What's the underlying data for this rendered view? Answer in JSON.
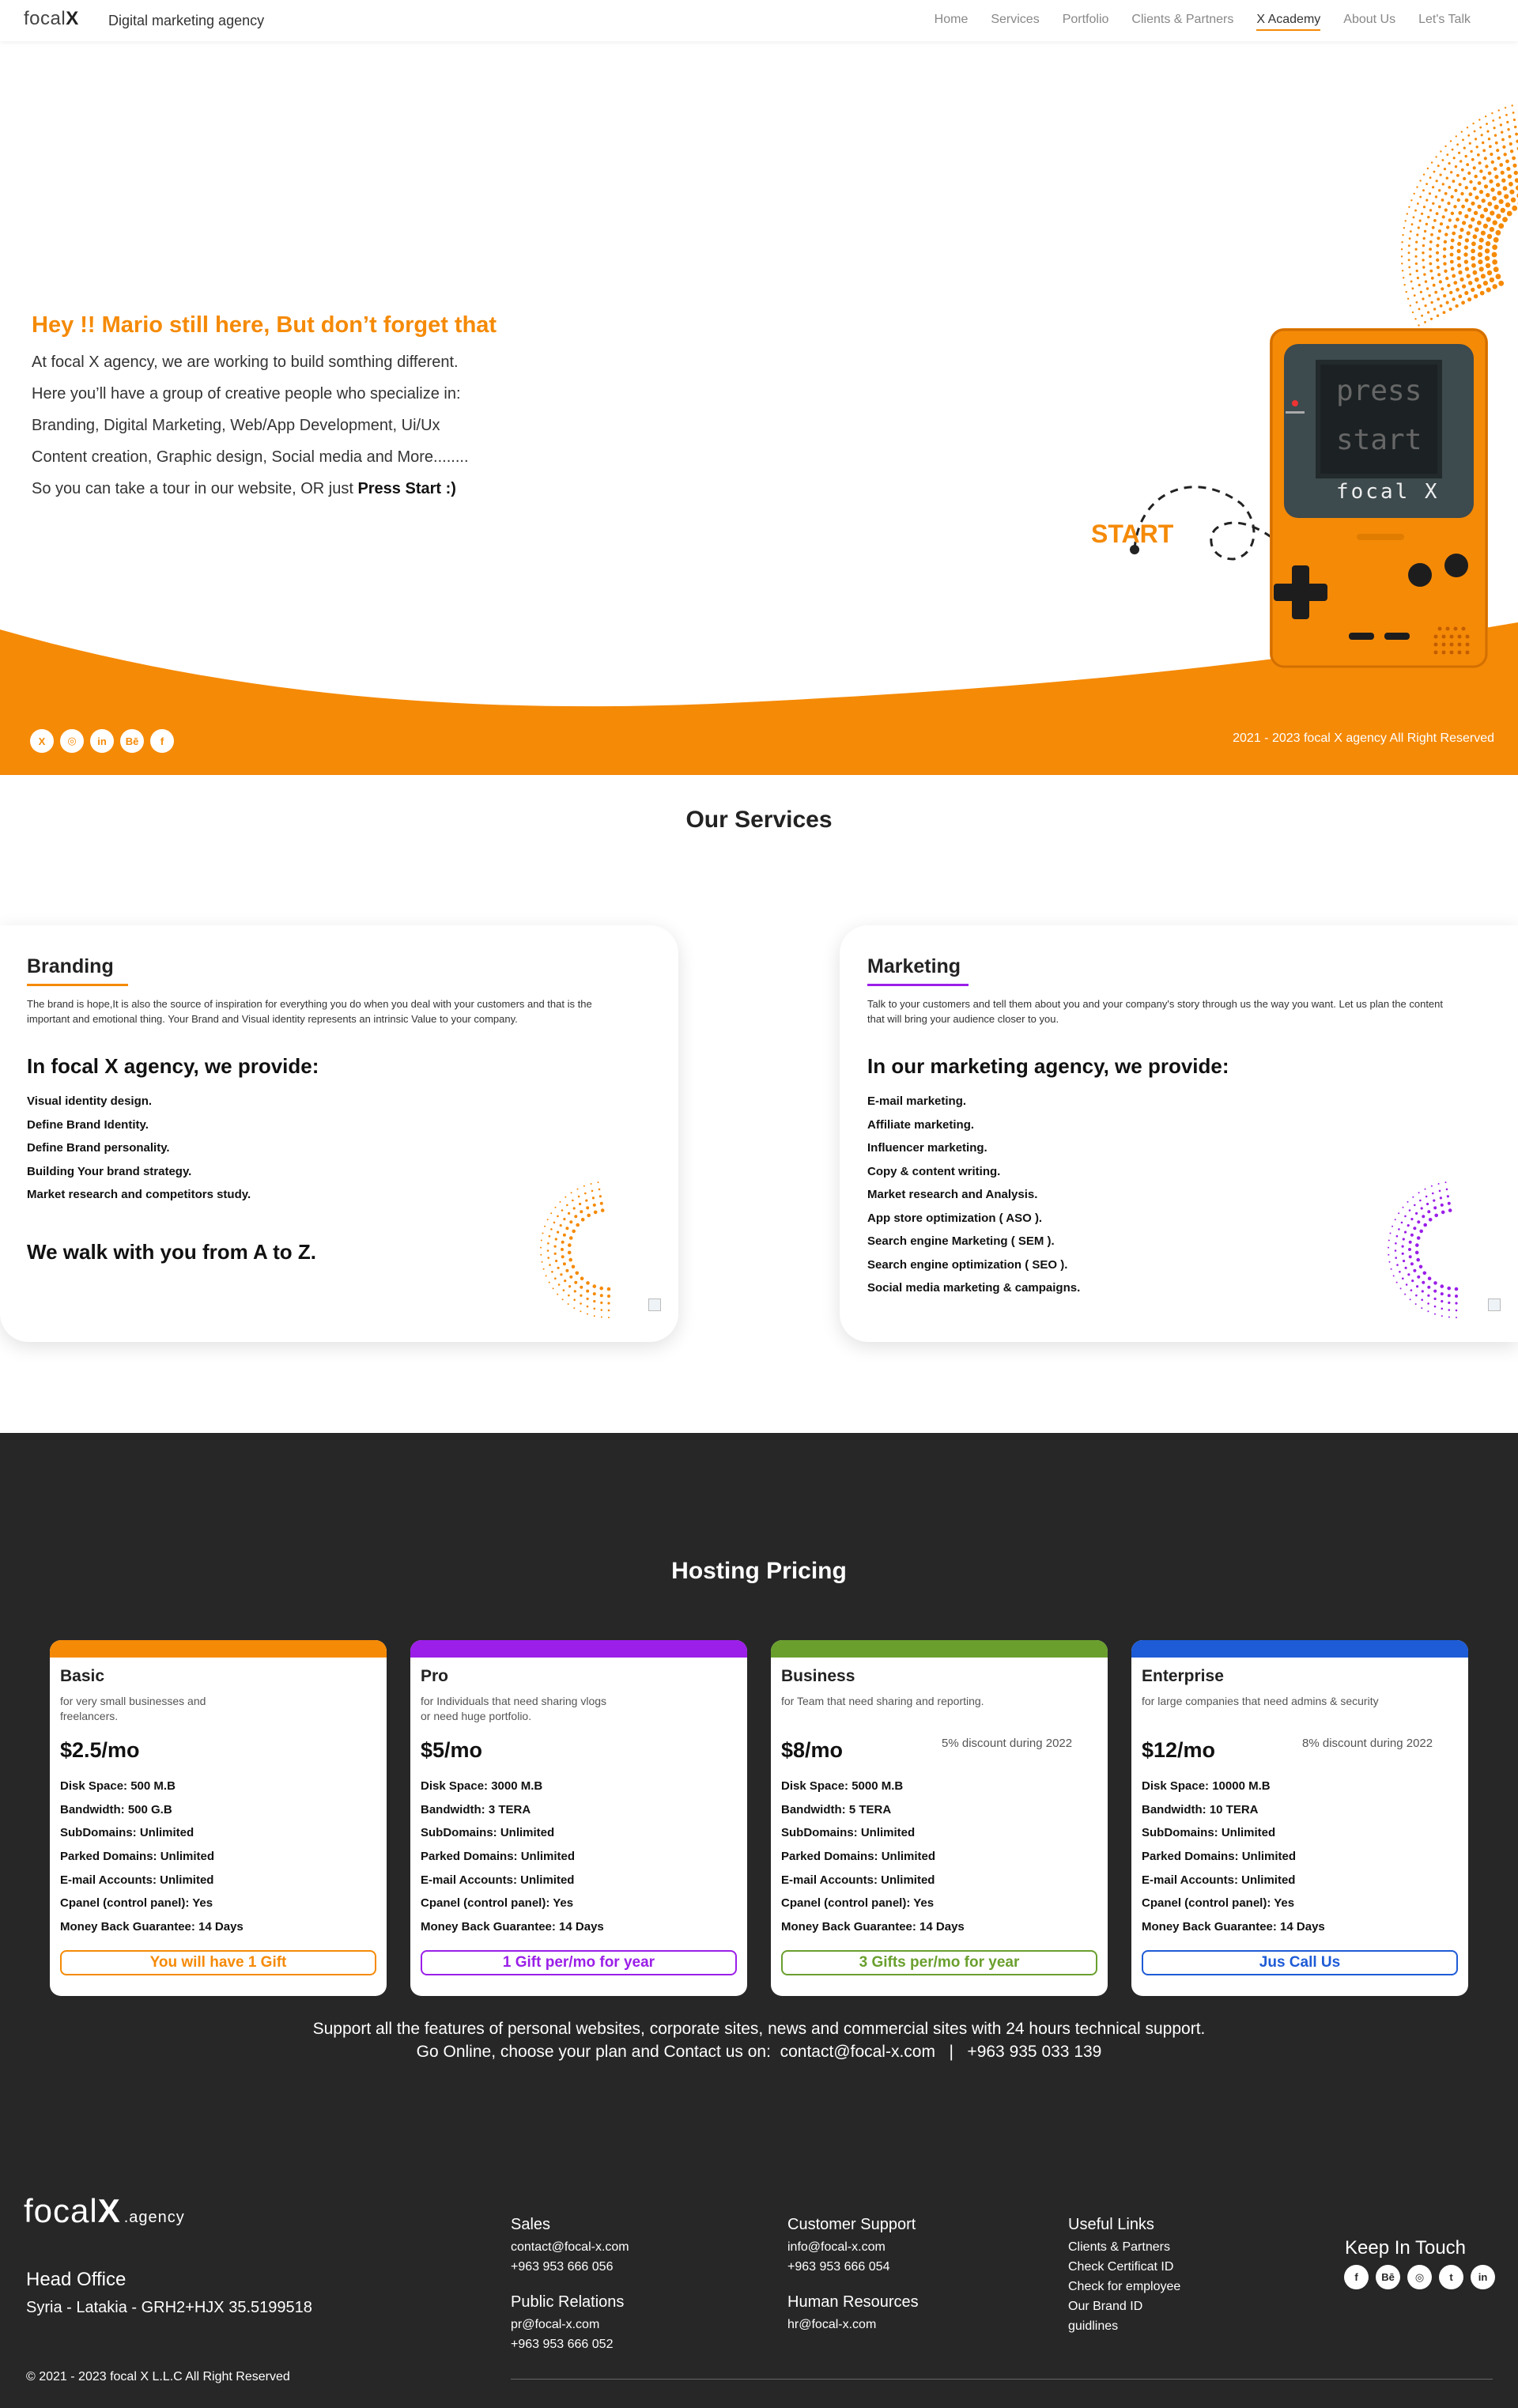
{
  "header": {
    "logo_prefix": "focal",
    "logo_x": "X",
    "tagline": "Digital marketing agency",
    "nav": [
      "Home",
      "Services",
      "Portfolio",
      "Clients & Partners",
      "X Academy",
      "About Us",
      "Let's Talk"
    ],
    "active_nav": "X Academy",
    "accent_color": "#f58a07"
  },
  "hero": {
    "title": "Hey !! Mario still here, But don’t forget that",
    "lines": [
      "At focal X agency, we are working to build somthing different.",
      "Here you’ll have a group of creative people who specialize in:",
      "Branding, Digital Marketing, Web/App Development, Ui/Ux",
      "Content creation, Graphic design, Social media and More........"
    ],
    "last_line_prefix": "So you can take a tour in our website, OR just ",
    "last_line_bold": "Press Start :)",
    "start_label": "START",
    "screen_line1": "press",
    "screen_line2": "start",
    "device_brand": "focal X",
    "social_icons": [
      "x-icon",
      "instagram-icon",
      "linkedin-icon",
      "behance-icon",
      "facebook-icon"
    ],
    "copyright": "2021 - 2023 focal X agency All Right Reserved"
  },
  "services": {
    "title": "Our Services",
    "branding": {
      "heading": "Branding",
      "description": "The brand is hope,It is also the source of inspiration for everything you do when you deal with your customers and that is the important and emotional thing. Your Brand and Visual identity represents an intrinsic Value to your company.",
      "provide": "In focal X agency, we provide:",
      "items": [
        "Visual identity design.",
        "Define Brand Identity.",
        "Define Brand personality.",
        "Building Your brand strategy.",
        "Market research and competitors study."
      ],
      "closing": "We walk with you from A to Z.",
      "accent": "#f58a07"
    },
    "marketing": {
      "heading": "Marketing",
      "description": "Talk to your customers and tell them about you and your company's story through us the way you want. Let us plan the content that will bring your audience closer to you.",
      "provide": "In our marketing agency, we provide:",
      "items": [
        "E-mail marketing.",
        "Affiliate marketing.",
        "Influencer marketing.",
        "Copy & content writing.",
        "Market research and Analysis.",
        "App store optimization ( ASO ).",
        "Search engine Marketing ( SEM ).",
        "Search engine optimization ( SEO ).",
        "Social media marketing & campaigns."
      ],
      "accent": "#9b1fe8"
    }
  },
  "pricing": {
    "title": "Hosting Pricing",
    "plans": [
      {
        "name": "Basic",
        "desc": "for very small businesses and freelancers.",
        "price": "$2.5/mo",
        "discount": "",
        "features": [
          "Disk Space: 500 M.B",
          "Bandwidth: 500 G.B",
          "SubDomains: Unlimited",
          "Parked Domains: Unlimited",
          "E-mail Accounts: Unlimited",
          "Cpanel (control panel): Yes",
          "Money Back Guarantee: 14 Days"
        ],
        "button": "You will have 1 Gift",
        "color": "#f58a07"
      },
      {
        "name": "Pro",
        "desc": "for Individuals that need sharing vlogs or need huge portfolio.",
        "price": "$5/mo",
        "discount": "",
        "features": [
          "Disk Space: 3000 M.B",
          "Bandwidth: 3 TERA",
          "SubDomains: Unlimited",
          "Parked Domains: Unlimited",
          "E-mail Accounts: Unlimited",
          "Cpanel (control panel): Yes",
          "Money Back Guarantee: 14 Days"
        ],
        "button": "1 Gift per/mo for year",
        "color": "#9b1fe8"
      },
      {
        "name": "Business",
        "desc": "for Team that need sharing and reporting.",
        "price": "$8/mo",
        "discount": "5% discount during 2022",
        "features": [
          "Disk Space: 5000 M.B",
          "Bandwidth: 5 TERA",
          "SubDomains: Unlimited",
          "Parked Domains: Unlimited",
          "E-mail Accounts: Unlimited",
          "Cpanel (control panel): Yes",
          "Money Back Guarantee: 14 Days"
        ],
        "button": "3 Gifts per/mo for year",
        "color": "#6a9f2e"
      },
      {
        "name": "Enterprise",
        "desc": "for large companies that need admins & security",
        "price": "$12/mo",
        "discount": "8% discount during 2022",
        "features": [
          "Disk Space: 10000 M.B",
          "Bandwidth: 10 TERA",
          "SubDomains: Unlimited",
          "Parked Domains: Unlimited",
          "E-mail Accounts: Unlimited",
          "Cpanel (control panel): Yes",
          "Money Back Guarantee: 14 Days"
        ],
        "button": "Jus Call Us",
        "color": "#1e5bd6"
      }
    ],
    "note_line1": "Support all the features of personal websites, corporate sites, news and commercial sites with 24 hours technical support.",
    "note_line2": "Go Online, choose your plan and Contact us on:  contact@focal-x.com   |   +963 935 033 139"
  },
  "footer": {
    "logo_prefix": "focal",
    "logo_x": "X",
    "logo_suffix": ".agency",
    "office_title": "Head Office",
    "office_address": "Syria - Latakia - GRH2+HJX 35.5199518",
    "sales_title": "Sales",
    "sales_email": "contact@focal-x.com",
    "sales_phone": "+963 953 666 056",
    "pr_title": "Public Relations",
    "pr_email": "pr@focal-x.com",
    "pr_phone": "+963 953 666 052",
    "support_title": "Customer Support",
    "support_email": "info@focal-x.com",
    "support_phone": "+963 953 666 054",
    "hr_title": "Human Resources",
    "hr_email": "hr@focal-x.com",
    "links_title": "Useful Links",
    "links": [
      "Clients & Partners",
      "Check Certificat ID",
      "Check for employee",
      "Our Brand ID",
      "guidlines"
    ],
    "keep_title": "Keep In Touch",
    "social_icons": [
      "facebook-icon",
      "behance-icon",
      "instagram-icon",
      "twitter-icon",
      "linkedin-icon"
    ],
    "copyright": "©  2021 - 2023 focal X L.L.C All Right Reserved"
  }
}
